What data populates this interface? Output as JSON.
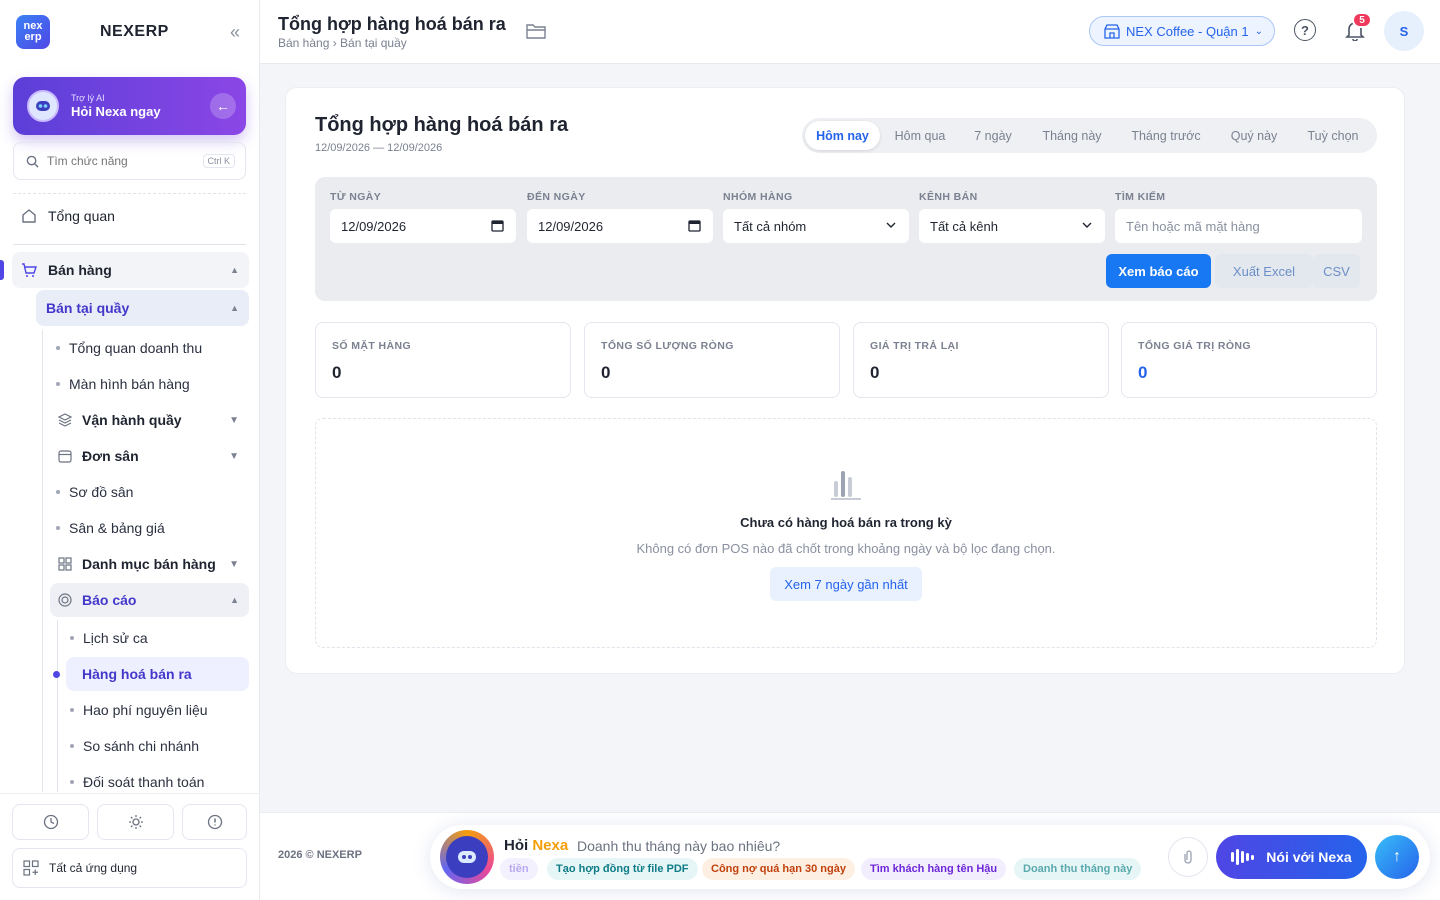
{
  "brand": {
    "name": "NEXERP",
    "logo_top": "nex",
    "logo_bottom": "erp"
  },
  "ai_card": {
    "small": "Trợ lý AI",
    "big": "Hỏi Nexa ngay"
  },
  "search": {
    "placeholder": "Tìm chức năng",
    "shortcut": "Ctrl K"
  },
  "nav": {
    "overview": "Tổng quan",
    "sales": "Bán hàng",
    "counter": "Bán tại quầy",
    "items": [
      "Tổng quan doanh thu",
      "Màn hình bán hàng",
      "Vận hành quầy",
      "Đơn sân",
      "Sơ đồ sân",
      "Sân & bảng giá",
      "Danh mục bán hàng",
      "Báo cáo"
    ],
    "report_items": [
      "Lịch sử ca",
      "Hàng hoá bán ra",
      "Hao phí nguyên liệu",
      "So sánh chi nhánh",
      "Đối soát thanh toán"
    ],
    "all_apps": "Tất cả ứng dụng"
  },
  "topbar": {
    "title": "Tổng hợp hàng hoá bán ra",
    "breadcrumb": "Bán hàng › Bán tại quầy",
    "branch": "NEX Coffee - Quận 1",
    "notifications": "5",
    "avatar": "S"
  },
  "report": {
    "title": "Tổng hợp hàng hoá bán ra",
    "range": "12/09/2026 — 12/09/2026",
    "periods": [
      "Hôm nay",
      "Hôm qua",
      "7 ngày",
      "Tháng này",
      "Tháng trước",
      "Quý này",
      "Tuỳ chọn"
    ],
    "active_period": "Hôm nay",
    "filters": {
      "from_label": "TỪ NGÀY",
      "from_value": "12/09/2026",
      "to_label": "ĐẾN NGÀY",
      "to_value": "12/09/2026",
      "group_label": "NHÓM HÀNG",
      "group_value": "Tất cả nhóm",
      "channel_label": "KÊNH BÁN",
      "channel_value": "Tất cả kênh",
      "search_label": "TÌM KIẾM",
      "search_placeholder": "Tên hoặc mã mặt hàng"
    },
    "buttons": {
      "view": "Xem báo cáo",
      "excel": "Xuất Excel",
      "csv": "CSV"
    },
    "stats": [
      {
        "label": "SỐ MẶT HÀNG",
        "value": "0"
      },
      {
        "label": "TỔNG SỐ LƯỢNG RÒNG",
        "value": "0"
      },
      {
        "label": "GIÁ TRỊ TRẢ LẠI",
        "value": "0"
      },
      {
        "label": "TỔNG GIÁ TRỊ RÒNG",
        "value": "0"
      }
    ],
    "empty": {
      "title": "Chưa có hàng hoá bán ra trong kỳ",
      "subtitle": "Không có đơn POS nào đã chốt trong khoảng ngày và bộ lọc đang chọn.",
      "button": "Xem 7 ngày gần nhất"
    }
  },
  "footer": {
    "copyright": "2026 © NEXERP",
    "nexa_title_a": "Hỏi",
    "nexa_title_b": "Nexa",
    "nexa_question": "Doanh thu tháng này bao nhiêu?",
    "chips": [
      "tiền",
      "Tạo hợp đồng từ file PDF",
      "Công nợ quá hạn 30 ngày",
      "Tìm khách hàng tên Hậu",
      "Doanh thu tháng này"
    ],
    "voice": "Nói với Nexa"
  },
  "colors": {
    "accent": "#2563eb",
    "brand_purple": "#4f46e5",
    "badge": "#ef3a5d"
  }
}
